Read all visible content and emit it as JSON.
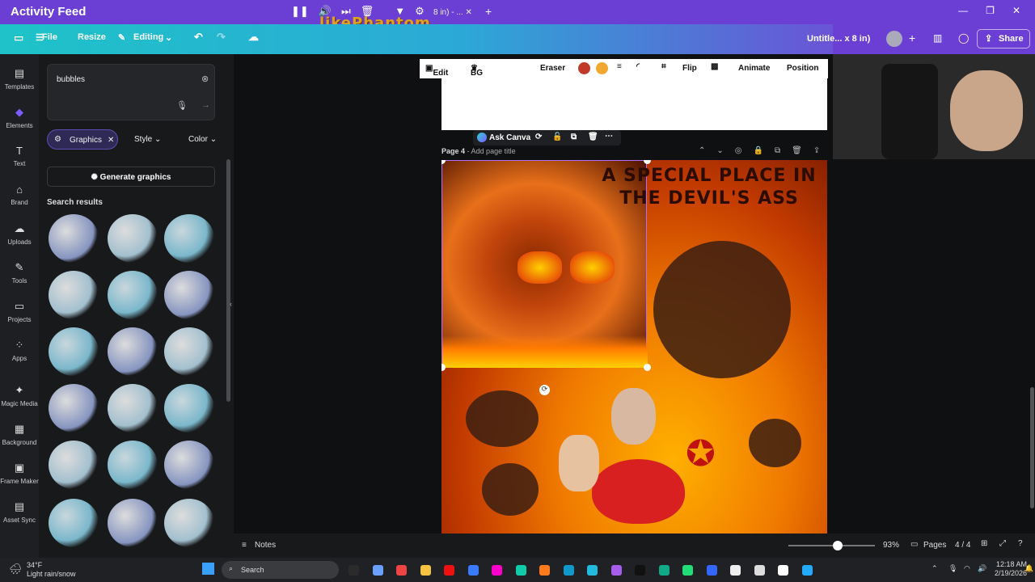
{
  "titlebar": {
    "stream_title": "Activity Feed",
    "tab_label": "8 in) - ...",
    "watermark": "likePhantom"
  },
  "toolbar": {
    "file": "File",
    "resize": "Resize",
    "editing": "Editing"
  },
  "toolbar_right": {
    "untitled": "Untitle... x 8 in)",
    "share": "Share"
  },
  "sidebar": {
    "items": [
      {
        "label": "Templates",
        "icon": "templates-icon"
      },
      {
        "label": "Elements",
        "icon": "elements-icon"
      },
      {
        "label": "Text",
        "icon": "text-icon"
      },
      {
        "label": "Brand",
        "icon": "brand-icon"
      },
      {
        "label": "Uploads",
        "icon": "uploads-icon"
      },
      {
        "label": "Tools",
        "icon": "tools-icon"
      },
      {
        "label": "Projects",
        "icon": "projects-icon"
      },
      {
        "label": "Apps",
        "icon": "apps-icon"
      },
      {
        "label": "Magic Media",
        "icon": "magic-media-icon"
      },
      {
        "label": "Background",
        "icon": "background-icon"
      },
      {
        "label": "Frame Maker",
        "icon": "frame-maker-icon"
      },
      {
        "label": "Asset Sync",
        "icon": "asset-sync-icon"
      }
    ]
  },
  "panel": {
    "search_value": "bubbles",
    "chips": {
      "graphics": "Graphics",
      "style": "Style",
      "color": "Color"
    },
    "generate": "Generate graphics",
    "results_label": "Search results"
  },
  "ctx_toolbar": {
    "edit": "Edit",
    "bg_remover": "BG Remover",
    "eraser": "Eraser",
    "flip": "Flip",
    "animate": "Animate",
    "position": "Position"
  },
  "askbar": {
    "label": "Ask Canva"
  },
  "page": {
    "number": "Page 4",
    "title_placeholder": "- Add page title"
  },
  "design": {
    "headline": "A SPECIAL PLACE IN THE DEVIL'S ASS"
  },
  "bottombar": {
    "notes": "Notes",
    "zoom": "93%",
    "pages": "Pages",
    "page_count": "4 / 4"
  },
  "taskbar": {
    "temp": "34°F",
    "weather": "Light rain/snow",
    "search": "Search",
    "time": "12:18 AM",
    "date": "2/19/2026"
  }
}
